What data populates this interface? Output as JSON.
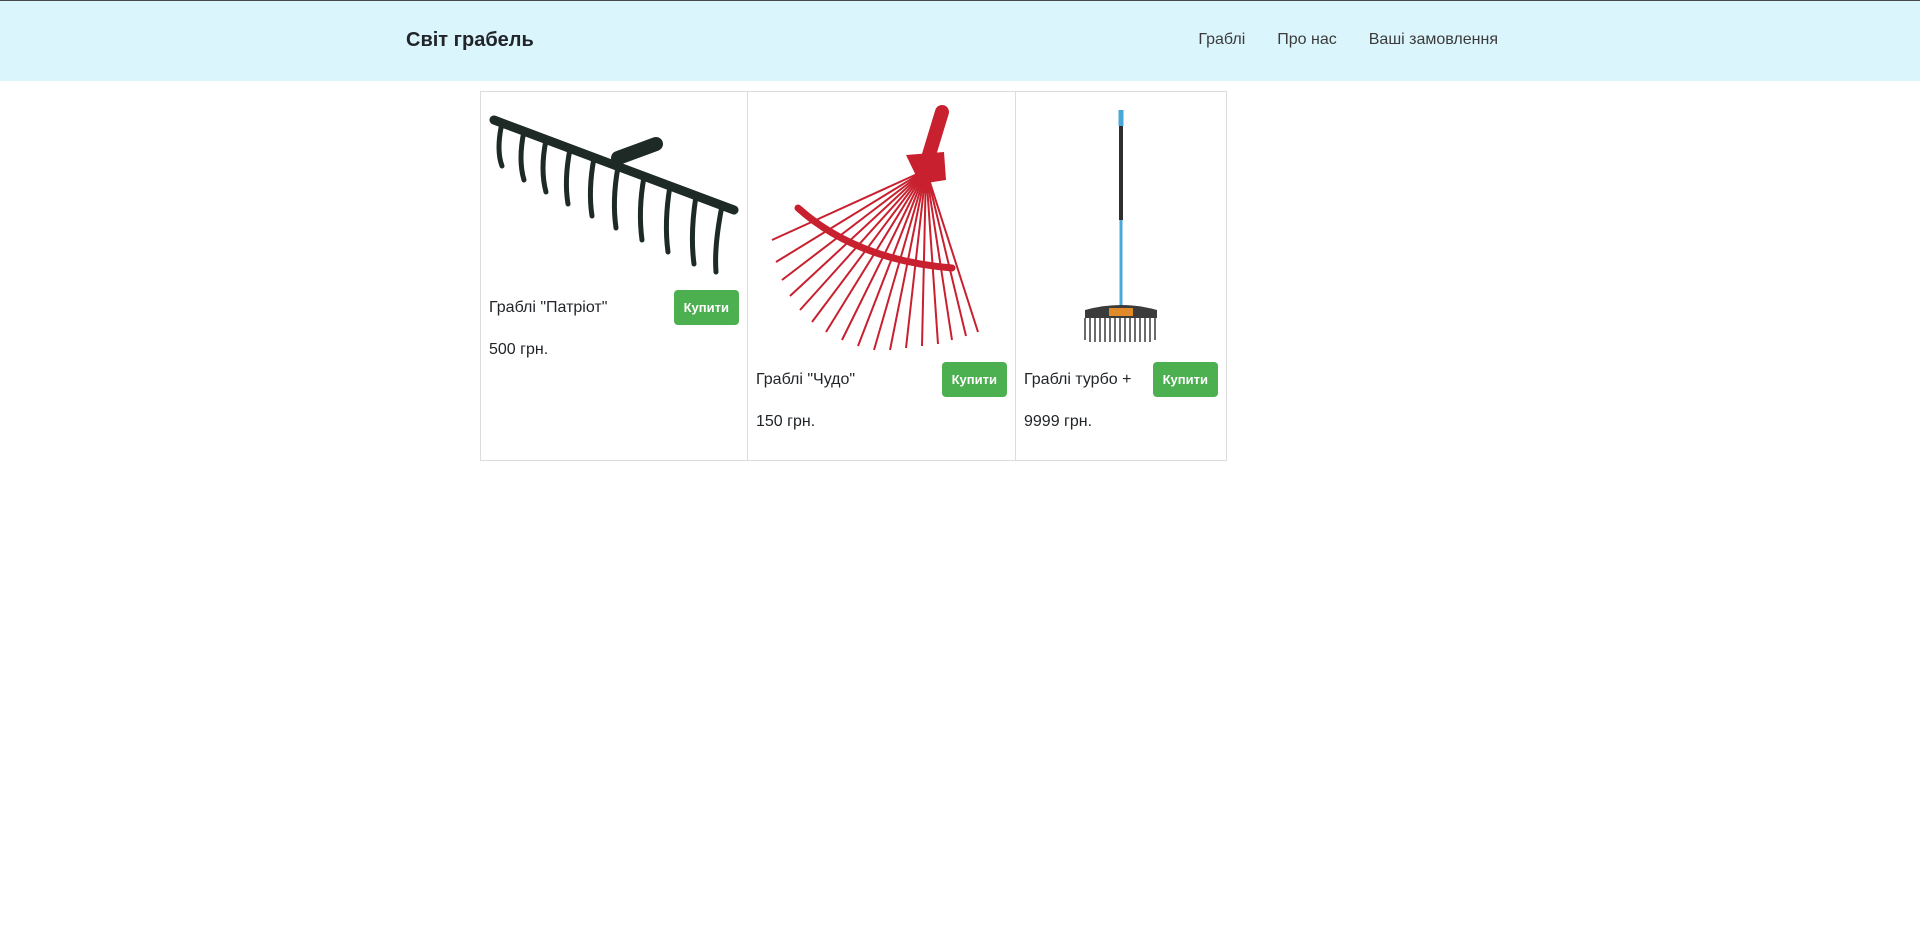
{
  "header": {
    "brand": "Світ грабель",
    "nav": [
      {
        "label": "Граблі"
      },
      {
        "label": "Про нас"
      },
      {
        "label": "Ваші замовлення"
      }
    ]
  },
  "products": [
    {
      "name": "Граблі \"Патріот\"",
      "price": "500 грн.",
      "buy_label": "Купити",
      "image_icon": "garden-rake-icon"
    },
    {
      "name": "Граблі \"Чудо\"",
      "price": "150 грн.",
      "buy_label": "Купити",
      "image_icon": "fan-rake-icon"
    },
    {
      "name": "Граблі турбо +",
      "price": "9999 грн.",
      "buy_label": "Купити",
      "image_icon": "long-handle-rake-icon"
    }
  ],
  "colors": {
    "navbar_bg": "#dbf5fc",
    "button_bg": "#4caf50",
    "rake1": "#1e2a26",
    "rake2": "#c8202e",
    "rake3_handle": "#4aa8d8"
  }
}
